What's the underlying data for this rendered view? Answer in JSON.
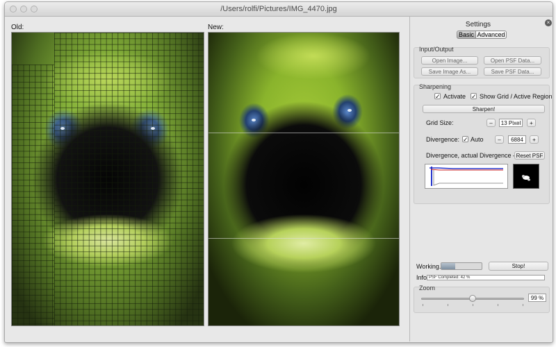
{
  "window": {
    "title": "/Users/rolfi/Pictures/IMG_4470.jpg"
  },
  "images": {
    "old_label": "Old:",
    "new_label": "New:"
  },
  "settings": {
    "title": "Settings",
    "tabs": [
      {
        "label": "Basic",
        "selected": true
      },
      {
        "label": "Advanced",
        "selected": false
      }
    ],
    "input_output": {
      "title": "Input/Output",
      "open_image": "Open Image...",
      "open_psf": "Open PSF Data...",
      "save_image": "Save Image As...",
      "save_psf": "Save PSF Data..."
    },
    "sharpening": {
      "title": "Sharpening",
      "activate_label": "Activate",
      "activate_checked": true,
      "show_grid_label": "Show Grid / Active Region",
      "show_grid_checked": true,
      "sharpen_button": "Sharpen!",
      "grid_size_label": "Grid Size:",
      "grid_size_value": "13 Pixel",
      "divergence_label": "Divergence:",
      "auto_label": "Auto",
      "auto_checked": true,
      "divergence_value": "6884",
      "psf_caption": "Divergence, actual Divergence – PSF:",
      "reset_psf_button": "Reset PSF",
      "minus_glyph": "–",
      "plus_glyph": "+"
    },
    "status": {
      "working_label": "Working...",
      "progress": 0.35,
      "stop_button": "Stop!",
      "info_label": "Info",
      "info_text": "PSF Completed: 42 %"
    },
    "zoom": {
      "title": "Zoom",
      "value": "99 %",
      "slider_fraction": 0.5
    }
  },
  "colors": {
    "graph_blue": "#2233cc",
    "graph_red": "#cc2222",
    "graph_grey": "#999999"
  }
}
